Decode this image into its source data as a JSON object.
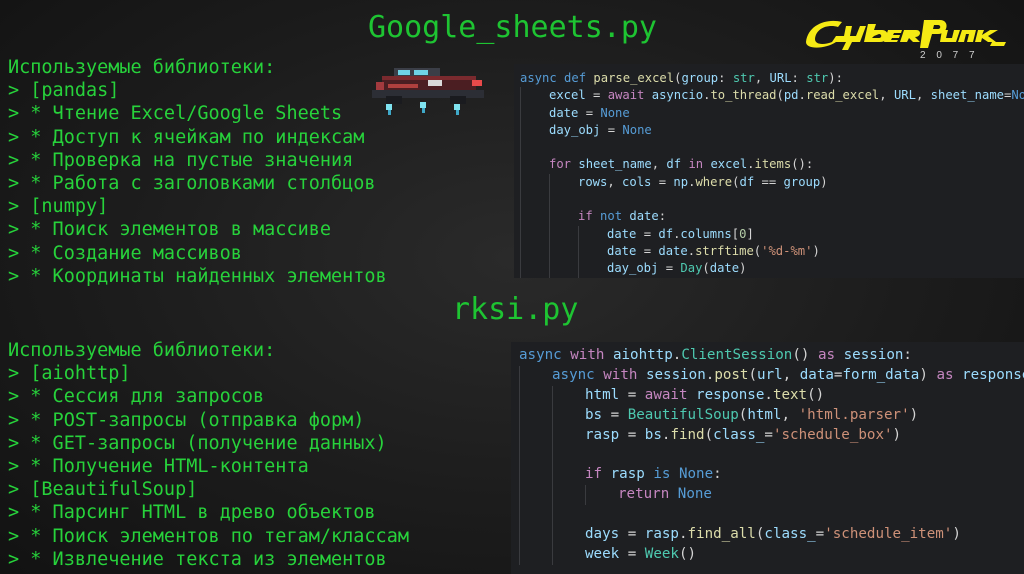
{
  "titles": {
    "google_sheets": "Google_sheets.py",
    "rksi": "rksi.py"
  },
  "logo": {
    "brand": "Cyberpunk",
    "year": "2 0 7 7"
  },
  "section1_libs": [
    "Используемые библиотеки:",
    "> [pandas]",
    "> * Чтение Excel/Google Sheets",
    "> * Доступ к ячейкам по индексам",
    "> * Проверка на пустые значения",
    "> * Работа с заголовками столбцов",
    "> [numpy]",
    "> * Поиск элементов в массиве",
    "> * Создание массивов",
    "> * Координаты найденных элементов"
  ],
  "section2_libs": [
    "Используемые библиотеки:",
    "> [aiohttp]",
    "> * Сессия для запросов",
    "> * POST-запросы (отправка форм)",
    "> * GET-запросы (получение данных)",
    "> * Получение HTML-контента",
    "> [BeautifulSoup]",
    "> * Парсинг HTML в древо объектов",
    "> * Поиск элементов по тегам/классам",
    "> * Извлечение текста из элементов"
  ],
  "code1": [
    {
      "indent": 0,
      "tokens": [
        [
          "kw",
          "async "
        ],
        [
          "kw",
          "def "
        ],
        [
          "fn",
          "parse_excel"
        ],
        [
          "p",
          "("
        ],
        [
          "prm",
          "group"
        ],
        [
          "p",
          ": "
        ],
        [
          "cls",
          "str"
        ],
        [
          "p",
          ", "
        ],
        [
          "prm",
          "URL"
        ],
        [
          "p",
          ": "
        ],
        [
          "cls",
          "str"
        ],
        [
          "p",
          "):"
        ]
      ]
    },
    {
      "indent": 1,
      "tokens": [
        [
          "var",
          "excel"
        ],
        [
          "p",
          " = "
        ],
        [
          "kw2",
          "await "
        ],
        [
          "var",
          "asyncio"
        ],
        [
          "p",
          "."
        ],
        [
          "fn",
          "to_thread"
        ],
        [
          "p",
          "("
        ],
        [
          "var",
          "pd"
        ],
        [
          "p",
          "."
        ],
        [
          "fn",
          "read_excel"
        ],
        [
          "p",
          ", "
        ],
        [
          "var",
          "URL"
        ],
        [
          "p",
          ", "
        ],
        [
          "prm",
          "sheet_name"
        ],
        [
          "p",
          "="
        ],
        [
          "kw",
          "None"
        ],
        [
          "p",
          ")"
        ]
      ]
    },
    {
      "indent": 1,
      "tokens": [
        [
          "var",
          "date"
        ],
        [
          "p",
          " = "
        ],
        [
          "kw",
          "None"
        ]
      ]
    },
    {
      "indent": 1,
      "tokens": [
        [
          "var",
          "day_obj"
        ],
        [
          "p",
          " = "
        ],
        [
          "kw",
          "None"
        ]
      ]
    },
    {
      "indent": 1,
      "tokens": []
    },
    {
      "indent": 1,
      "tokens": [
        [
          "kw2",
          "for "
        ],
        [
          "var",
          "sheet_name"
        ],
        [
          "p",
          ", "
        ],
        [
          "var",
          "df"
        ],
        [
          "kw2",
          " in "
        ],
        [
          "var",
          "excel"
        ],
        [
          "p",
          "."
        ],
        [
          "fn",
          "items"
        ],
        [
          "p",
          "():"
        ]
      ]
    },
    {
      "indent": 2,
      "tokens": [
        [
          "var",
          "rows"
        ],
        [
          "p",
          ", "
        ],
        [
          "var",
          "cols"
        ],
        [
          "p",
          " = "
        ],
        [
          "var",
          "np"
        ],
        [
          "p",
          "."
        ],
        [
          "fn",
          "where"
        ],
        [
          "p",
          "("
        ],
        [
          "var",
          "df"
        ],
        [
          "p",
          " == "
        ],
        [
          "var",
          "group"
        ],
        [
          "p",
          ")"
        ]
      ]
    },
    {
      "indent": 2,
      "tokens": []
    },
    {
      "indent": 2,
      "tokens": [
        [
          "kw2",
          "if "
        ],
        [
          "kw",
          "not "
        ],
        [
          "var",
          "date"
        ],
        [
          "p",
          ":"
        ]
      ]
    },
    {
      "indent": 3,
      "tokens": [
        [
          "var",
          "date"
        ],
        [
          "p",
          " = "
        ],
        [
          "var",
          "df"
        ],
        [
          "p",
          "."
        ],
        [
          "var",
          "columns"
        ],
        [
          "p",
          "["
        ],
        [
          "num",
          "0"
        ],
        [
          "p",
          "]"
        ]
      ]
    },
    {
      "indent": 3,
      "tokens": [
        [
          "var",
          "date"
        ],
        [
          "p",
          " = "
        ],
        [
          "var",
          "date"
        ],
        [
          "p",
          "."
        ],
        [
          "fn",
          "strftime"
        ],
        [
          "p",
          "("
        ],
        [
          "str",
          "'%d-%m'"
        ],
        [
          "p",
          ")"
        ]
      ]
    },
    {
      "indent": 3,
      "tokens": [
        [
          "var",
          "day_obj"
        ],
        [
          "p",
          " = "
        ],
        [
          "cls",
          "Day"
        ],
        [
          "p",
          "("
        ],
        [
          "var",
          "date"
        ],
        [
          "p",
          ")"
        ]
      ]
    }
  ],
  "code2": [
    {
      "indent": 0,
      "tokens": [
        [
          "kw",
          "async "
        ],
        [
          "kw2",
          "with "
        ],
        [
          "var",
          "aiohttp"
        ],
        [
          "p",
          "."
        ],
        [
          "cls",
          "ClientSession"
        ],
        [
          "p",
          "() "
        ],
        [
          "kw2",
          "as "
        ],
        [
          "var",
          "session"
        ],
        [
          "p",
          ":"
        ]
      ]
    },
    {
      "indent": 1,
      "tokens": [
        [
          "kw",
          "async "
        ],
        [
          "kw2",
          "with "
        ],
        [
          "var",
          "session"
        ],
        [
          "p",
          "."
        ],
        [
          "fn",
          "post"
        ],
        [
          "p",
          "("
        ],
        [
          "var",
          "url"
        ],
        [
          "p",
          ", "
        ],
        [
          "prm",
          "data"
        ],
        [
          "p",
          "="
        ],
        [
          "var",
          "form_data"
        ],
        [
          "p",
          ") "
        ],
        [
          "kw2",
          "as "
        ],
        [
          "var",
          "response"
        ],
        [
          "p",
          ":"
        ]
      ]
    },
    {
      "indent": 2,
      "tokens": [
        [
          "var",
          "html"
        ],
        [
          "p",
          " = "
        ],
        [
          "kw2",
          "await "
        ],
        [
          "var",
          "response"
        ],
        [
          "p",
          "."
        ],
        [
          "fn",
          "text"
        ],
        [
          "p",
          "()"
        ]
      ]
    },
    {
      "indent": 2,
      "tokens": [
        [
          "var",
          "bs"
        ],
        [
          "p",
          " = "
        ],
        [
          "cls",
          "BeautifulSoup"
        ],
        [
          "p",
          "("
        ],
        [
          "var",
          "html"
        ],
        [
          "p",
          ", "
        ],
        [
          "str",
          "'html.parser'"
        ],
        [
          "p",
          ")"
        ]
      ]
    },
    {
      "indent": 2,
      "tokens": [
        [
          "var",
          "rasp"
        ],
        [
          "p",
          " = "
        ],
        [
          "var",
          "bs"
        ],
        [
          "p",
          "."
        ],
        [
          "fn",
          "find"
        ],
        [
          "p",
          "("
        ],
        [
          "prm",
          "class_"
        ],
        [
          "p",
          "="
        ],
        [
          "str",
          "'schedule_box'"
        ],
        [
          "p",
          ")"
        ]
      ]
    },
    {
      "indent": 2,
      "tokens": []
    },
    {
      "indent": 2,
      "tokens": [
        [
          "kw2",
          "if "
        ],
        [
          "var",
          "rasp"
        ],
        [
          "kw",
          " is "
        ],
        [
          "kw",
          "None"
        ],
        [
          "p",
          ":"
        ]
      ]
    },
    {
      "indent": 3,
      "tokens": [
        [
          "kw2",
          "return "
        ],
        [
          "kw",
          "None"
        ]
      ]
    },
    {
      "indent": 2,
      "tokens": []
    },
    {
      "indent": 2,
      "tokens": [
        [
          "var",
          "days"
        ],
        [
          "p",
          " = "
        ],
        [
          "var",
          "rasp"
        ],
        [
          "p",
          "."
        ],
        [
          "fn",
          "find_all"
        ],
        [
          "p",
          "("
        ],
        [
          "prm",
          "class_"
        ],
        [
          "p",
          "="
        ],
        [
          "str",
          "'schedule_item'"
        ],
        [
          "p",
          ")"
        ]
      ]
    },
    {
      "indent": 2,
      "tokens": [
        [
          "var",
          "week"
        ],
        [
          "p",
          " = "
        ],
        [
          "cls",
          "Week"
        ],
        [
          "p",
          "()"
        ]
      ]
    }
  ],
  "colors": {
    "title": "#1ec432",
    "list_text": "#27d23b",
    "code_bg": "#1e1f22",
    "logo_yellow": "#f5ea14"
  }
}
